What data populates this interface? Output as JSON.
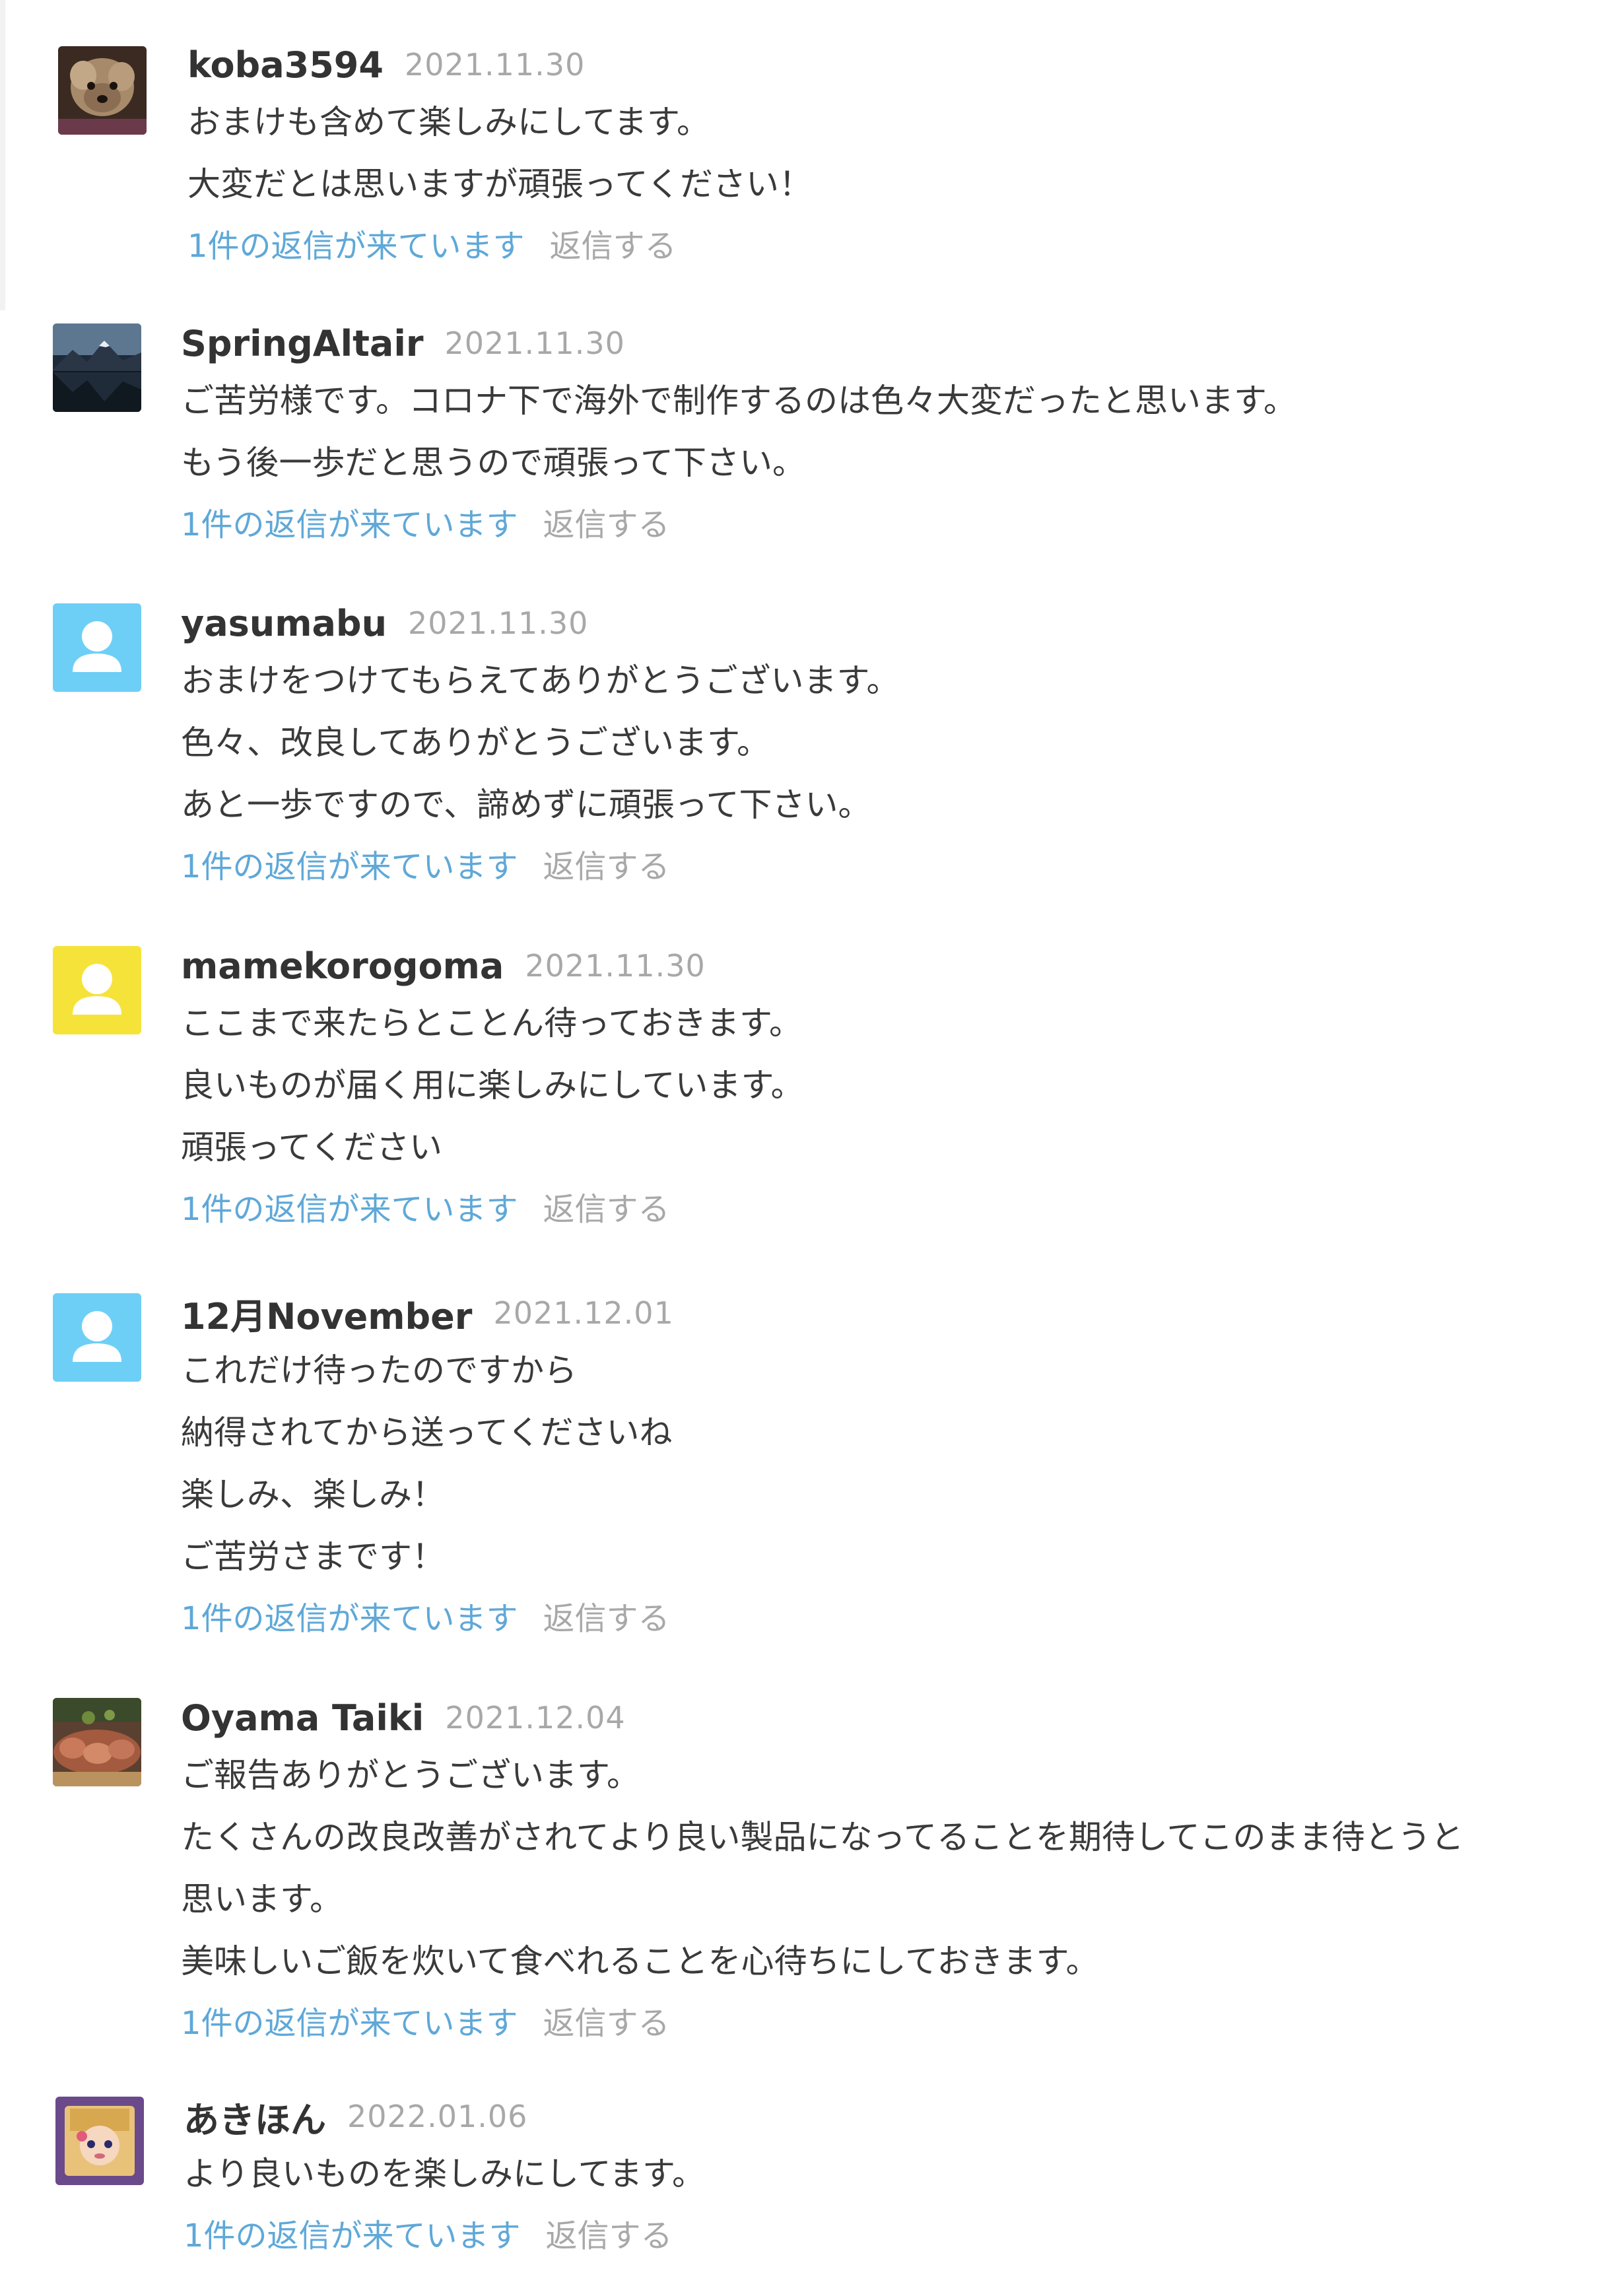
{
  "comments": [
    {
      "username": "koba3594",
      "date": "2021.11.30",
      "lines": [
        "おまけも含めて楽しみにしてます。",
        "大変だとは思いますが頑張ってください！"
      ],
      "replies_label": "1件の返信が来ています",
      "reply_label": "返信する",
      "avatar": "dog-photo"
    },
    {
      "username": "SpringAltair",
      "date": "2021.11.30",
      "lines": [
        "ご苦労様です。コロナ下で海外で制作するのは色々大変だったと思います。",
        "もう後一歩だと思うので頑張って下さい。"
      ],
      "replies_label": "1件の返信が来ています",
      "reply_label": "返信する",
      "avatar": "mountain-lake-photo"
    },
    {
      "username": "yasumabu",
      "date": "2021.11.30",
      "lines": [
        "おまけをつけてもらえてありがとうございます。",
        "色々、改良してありがとうございます。",
        "あと一歩ですので、諦めずに頑張って下さい。"
      ],
      "replies_label": "1件の返信が来ています",
      "reply_label": "返信する",
      "avatar": "default-user",
      "avatar_color": "#6ecff6"
    },
    {
      "username": "mamekorogoma",
      "date": "2021.11.30",
      "lines": [
        "ここまで来たらとことん待っておきます。",
        "良いものが届く用に楽しみにしています。",
        "頑張ってください"
      ],
      "replies_label": "1件の返信が来ています",
      "reply_label": "返信する",
      "avatar": "default-user",
      "avatar_color": "#f6e33a"
    },
    {
      "username": "12月November",
      "date": "2021.12.01",
      "lines": [
        "これだけ待ったのですから",
        "納得されてから送ってくださいね",
        "楽しみ、楽しみ！",
        "ご苦労さまです！"
      ],
      "replies_label": "1件の返信が来ています",
      "reply_label": "返信する",
      "avatar": "default-user",
      "avatar_color": "#6ecff6"
    },
    {
      "username": "Oyama Taiki",
      "date": "2021.12.04",
      "lines": [
        "ご報告ありがとうございます。",
        "たくさんの改良改善がされてより良い製品になってることを期待してこのまま待とうと",
        "思います。",
        "美味しいご飯を炊いて食べれることを心待ちにしておきます。"
      ],
      "replies_label": "1件の返信が来ています",
      "reply_label": "返信する",
      "avatar": "food-photo"
    },
    {
      "username": "あきほん",
      "date": "2022.01.06",
      "lines": [
        "より良いものを楽しみにしてます。"
      ],
      "replies_label": "1件の返信が来ています",
      "reply_label": "返信する",
      "avatar": "doll-photo"
    }
  ]
}
